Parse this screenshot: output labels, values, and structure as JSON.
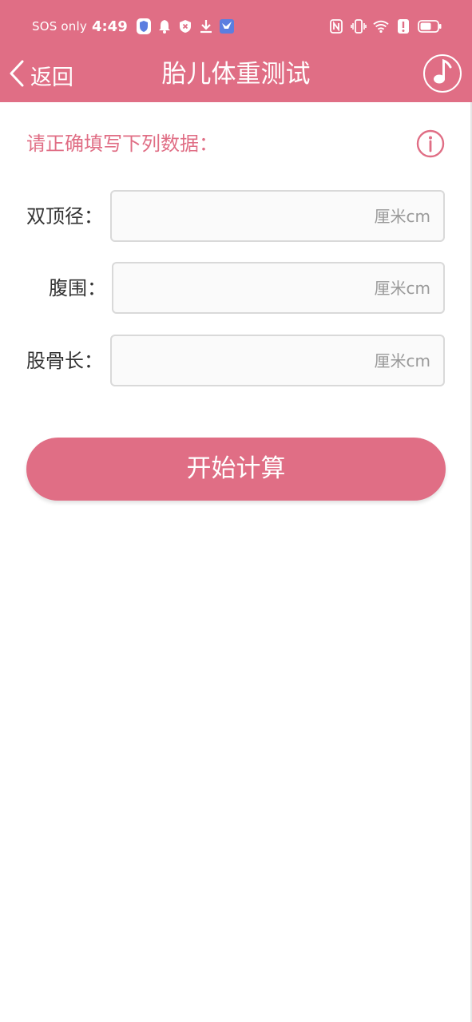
{
  "status_bar": {
    "carrier": "SOS only",
    "time": "4:49"
  },
  "header": {
    "back_label": "返回",
    "title": "胎儿体重测试"
  },
  "form": {
    "instruction": "请正确填写下列数据：",
    "fields": [
      {
        "label": "双顶径：",
        "value": "",
        "placeholder": "厘米cm"
      },
      {
        "label": "腹围：",
        "value": "",
        "placeholder": "厘米cm"
      },
      {
        "label": "股骨长：",
        "value": "",
        "placeholder": "厘米cm"
      }
    ]
  },
  "actions": {
    "calculate_label": "开始计算"
  },
  "colors": {
    "accent": "#e06e85",
    "input_border": "#d9d9d9",
    "placeholder": "#999999"
  }
}
